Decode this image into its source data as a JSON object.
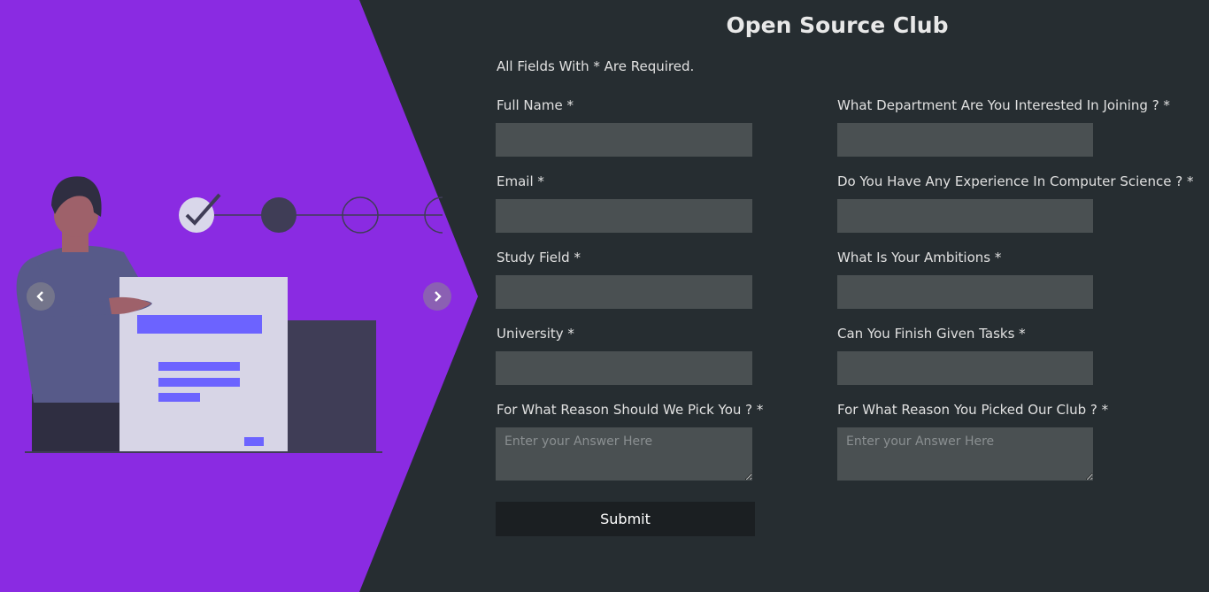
{
  "colors": {
    "accent_purple": "#8a2be2",
    "background": "#262d31",
    "input_background": "#4a5052",
    "submit_background": "#1b1f22",
    "illustration_primary": "#6c63ff"
  },
  "carousel": {
    "prev_icon": "chevron-left-icon",
    "next_icon": "chevron-right-icon",
    "steps": [
      "completed",
      "current",
      "pending",
      "pending"
    ]
  },
  "form": {
    "title": "Open Source Club",
    "required_note": "All Fields With * Are Required.",
    "fields_left": [
      {
        "label": "Full Name *",
        "value": ""
      },
      {
        "label": "Email *",
        "value": ""
      },
      {
        "label": "Study Field *",
        "value": ""
      },
      {
        "label": "University *",
        "value": ""
      }
    ],
    "fields_right": [
      {
        "label": "What Department Are You Interested In Joining ? *",
        "value": ""
      },
      {
        "label": "Do You Have Any Experience In Computer Science ? *",
        "value": ""
      },
      {
        "label": "What Is Your Ambitions *",
        "value": ""
      },
      {
        "label": "Can You Finish Given Tasks *",
        "value": ""
      }
    ],
    "textarea_left": {
      "label": "For What Reason Should We Pick You ? *",
      "placeholder": "Enter your Answer Here"
    },
    "textarea_right": {
      "label": "For What Reason You Picked Our Club ? *",
      "placeholder": "Enter your Answer Here"
    },
    "submit_label": "Submit"
  }
}
